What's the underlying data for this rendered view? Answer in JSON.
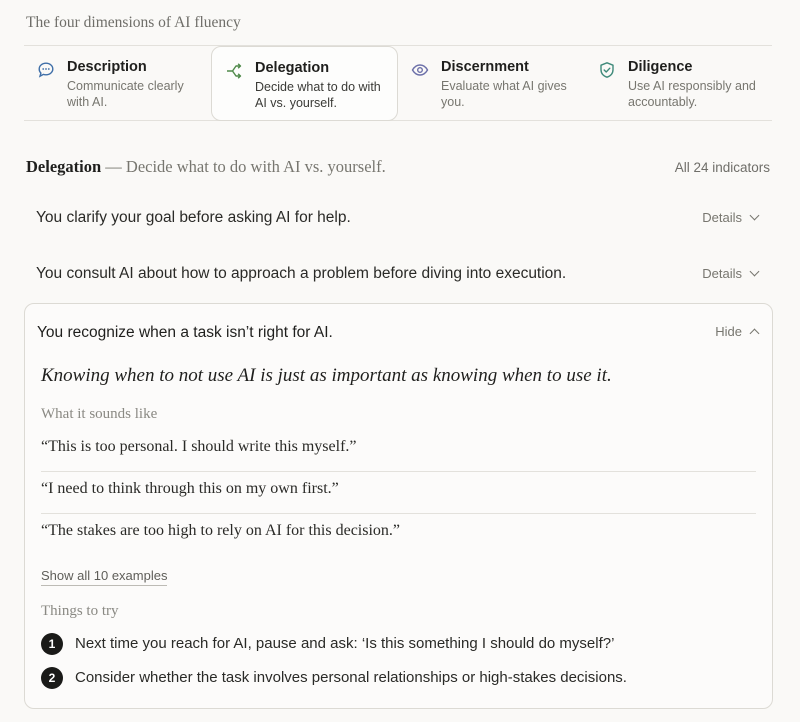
{
  "page": {
    "heading": "The four dimensions of AI fluency"
  },
  "dimensions": [
    {
      "name": "Description",
      "desc": "Communicate clearly with AI.",
      "icon": "chat-bubble-icon",
      "active": false
    },
    {
      "name": "Delegation",
      "desc": "Decide what to do with AI vs. yourself.",
      "icon": "branch-arrows-icon",
      "active": true
    },
    {
      "name": "Discernment",
      "desc": "Evaluate what AI gives you.",
      "icon": "eye-icon",
      "active": false
    },
    {
      "name": "Diligence",
      "desc": "Use AI responsibly and accountably.",
      "icon": "shield-check-icon",
      "active": false
    }
  ],
  "section": {
    "name": "Delegation",
    "desc": " — Decide what to do with AI vs. yourself.",
    "all_indicators": "All 24 indicators"
  },
  "indicators": [
    {
      "text": "You clarify your goal before asking AI for help.",
      "toggle": "Details"
    },
    {
      "text": "You consult AI about how to approach a problem before diving into execution.",
      "toggle": "Details"
    }
  ],
  "expanded": {
    "text": "You recognize when a task isn’t right for AI.",
    "toggle": "Hide",
    "quote": "Knowing when to not use AI is just as important as knowing when to use it.",
    "sounds_like_label": "What it sounds like",
    "examples": [
      "“This is too personal. I should write this myself.”",
      "“I need to think through this on my own first.”",
      "“The stakes are too high to rely on AI for this decision.”"
    ],
    "show_all": "Show all 10 examples",
    "try_label": "Things to try",
    "tries": [
      {
        "num": "1",
        "text": "Next time you reach for AI, pause and ask: ‘Is this something I should do myself?’"
      },
      {
        "num": "2",
        "text": "Consider whether the task involves personal relationships or high-stakes decisions."
      }
    ]
  },
  "colors": {
    "accent_green": "#4f8a4a",
    "icon_blue": "#3f6fa8",
    "icon_purple": "#6b6fa8",
    "icon_teal": "#3f8a7a"
  }
}
